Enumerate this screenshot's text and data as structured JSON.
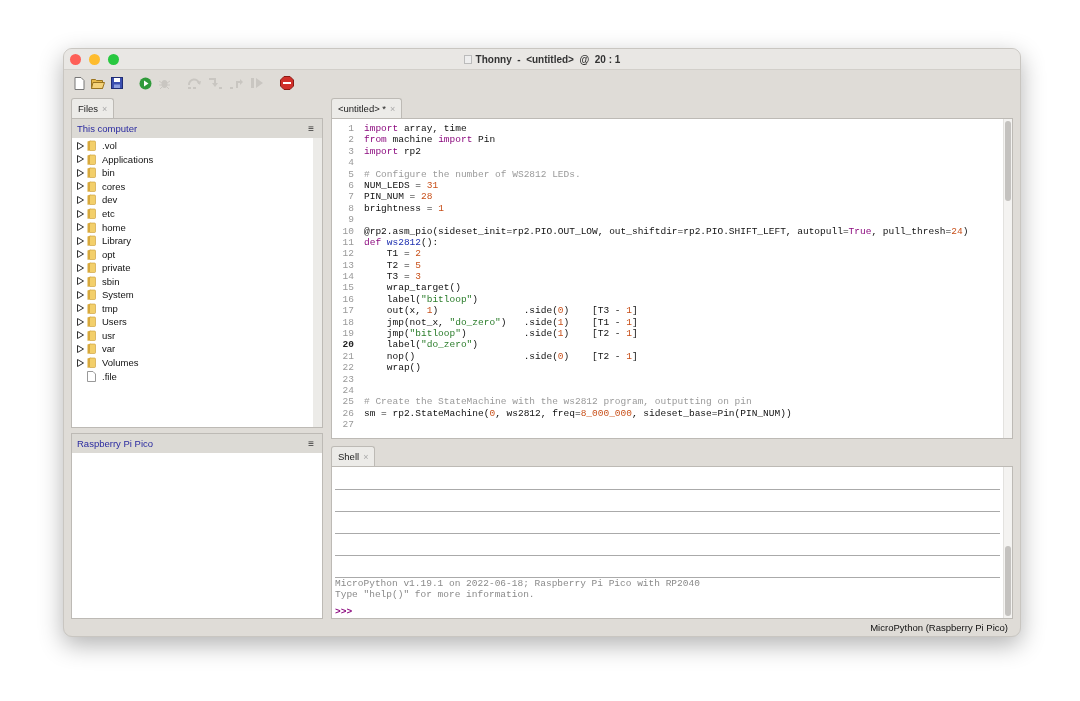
{
  "window": {
    "title": "Thonny  -  <untitled>  @  20 : 1"
  },
  "toolbar": [
    {
      "kind": "new",
      "disabled": false
    },
    {
      "kind": "open",
      "disabled": false
    },
    {
      "kind": "save",
      "disabled": false
    },
    {
      "kind": "run",
      "disabled": false
    },
    {
      "kind": "debug",
      "disabled": true
    },
    {
      "kind": "step_over",
      "disabled": true
    },
    {
      "kind": "step_into",
      "disabled": true
    },
    {
      "kind": "step_out",
      "disabled": true
    },
    {
      "kind": "resume",
      "disabled": true
    },
    {
      "kind": "stop",
      "disabled": false
    }
  ],
  "files": {
    "tab": {
      "label": "Files",
      "close": "×",
      "selected": true
    },
    "local": {
      "title": "This computer",
      "menu": "≡",
      "items": [
        {
          "name": ".vol",
          "kind": "folder",
          "expanded": false
        },
        {
          "name": "Applications",
          "kind": "folder",
          "expanded": false
        },
        {
          "name": "bin",
          "kind": "folder",
          "expanded": false
        },
        {
          "name": "cores",
          "kind": "folder",
          "expanded": false
        },
        {
          "name": "dev",
          "kind": "folder",
          "expanded": false
        },
        {
          "name": "etc",
          "kind": "folder",
          "expanded": false
        },
        {
          "name": "home",
          "kind": "folder",
          "expanded": false
        },
        {
          "name": "Library",
          "kind": "folder",
          "expanded": false
        },
        {
          "name": "opt",
          "kind": "folder",
          "expanded": false
        },
        {
          "name": "private",
          "kind": "folder",
          "expanded": false
        },
        {
          "name": "sbin",
          "kind": "folder",
          "expanded": false
        },
        {
          "name": "System",
          "kind": "folder",
          "expanded": false
        },
        {
          "name": "tmp",
          "kind": "folder",
          "expanded": false
        },
        {
          "name": "Users",
          "kind": "folder",
          "expanded": false
        },
        {
          "name": "usr",
          "kind": "folder",
          "expanded": false
        },
        {
          "name": "var",
          "kind": "folder",
          "expanded": false
        },
        {
          "name": "Volumes",
          "kind": "folder",
          "expanded": false
        },
        {
          "name": ".file",
          "kind": "file"
        }
      ]
    },
    "device": {
      "title": "Raspberry Pi Pico",
      "menu": "≡"
    }
  },
  "editor": {
    "tab": {
      "label": "<untitled> *",
      "close": "×",
      "selected": true
    },
    "lines": [
      {
        "number": "1",
        "current": false,
        "segments": [
          {
            "kind": "kw",
            "text": "import"
          },
          {
            "kind": "txt",
            "text": " array, time"
          }
        ]
      },
      {
        "number": "2",
        "current": false,
        "segments": [
          {
            "kind": "kw",
            "text": "from"
          },
          {
            "kind": "txt",
            "text": " machine "
          },
          {
            "kind": "kw",
            "text": "import"
          },
          {
            "kind": "txt",
            "text": " Pin"
          }
        ]
      },
      {
        "number": "3",
        "current": false,
        "segments": [
          {
            "kind": "kw",
            "text": "import"
          },
          {
            "kind": "txt",
            "text": " rp2"
          }
        ]
      },
      {
        "number": "4",
        "current": false
      },
      {
        "number": "5",
        "current": false,
        "segments": [
          {
            "kind": "com",
            "text": "# Configure the number of WS2812 LEDs."
          }
        ]
      },
      {
        "number": "6",
        "current": false,
        "segments": [
          {
            "kind": "txt",
            "text": "NUM_LEDS = "
          },
          {
            "kind": "num",
            "text": "31"
          }
        ]
      },
      {
        "number": "7",
        "current": false,
        "segments": [
          {
            "kind": "txt",
            "text": "PIN_NUM = "
          },
          {
            "kind": "num",
            "text": "28"
          }
        ]
      },
      {
        "number": "8",
        "current": false,
        "segments": [
          {
            "kind": "txt",
            "text": "brightness = "
          },
          {
            "kind": "num",
            "text": "1"
          }
        ]
      },
      {
        "number": "9",
        "current": false
      },
      {
        "number": "10",
        "current": false,
        "segments": [
          {
            "kind": "txt",
            "text": "@rp2.asm_pio(sideset_init=rp2.PIO.OUT_LOW, out_shiftdir=rp2.PIO.SHIFT_LEFT, autopull="
          },
          {
            "kind": "kw",
            "text": "True"
          },
          {
            "kind": "txt",
            "text": ", pull_thresh="
          },
          {
            "kind": "num",
            "text": "24"
          },
          {
            "kind": "txt",
            "text": ")"
          }
        ]
      },
      {
        "number": "11",
        "current": false,
        "segments": [
          {
            "kind": "kw",
            "text": "def"
          },
          {
            "kind": "fn",
            "text": " ws2812"
          },
          {
            "kind": "txt",
            "text": "():"
          }
        ]
      },
      {
        "number": "12",
        "current": false,
        "segments": [
          {
            "kind": "txt",
            "text": "    T1 = "
          },
          {
            "kind": "num",
            "text": "2"
          }
        ]
      },
      {
        "number": "13",
        "current": false,
        "segments": [
          {
            "kind": "txt",
            "text": "    T2 = "
          },
          {
            "kind": "num",
            "text": "5"
          }
        ]
      },
      {
        "number": "14",
        "current": false,
        "segments": [
          {
            "kind": "txt",
            "text": "    T3 = "
          },
          {
            "kind": "num",
            "text": "3"
          }
        ]
      },
      {
        "number": "15",
        "current": false,
        "segments": [
          {
            "kind": "txt",
            "text": "    wrap_target()"
          }
        ]
      },
      {
        "number": "16",
        "current": false,
        "segments": [
          {
            "kind": "txt",
            "text": "    label("
          },
          {
            "kind": "str",
            "text": "\"bitloop\""
          },
          {
            "kind": "txt",
            "text": ")"
          }
        ]
      },
      {
        "number": "17",
        "current": false,
        "segments": [
          {
            "kind": "txt",
            "text": "    out(x, "
          },
          {
            "kind": "num",
            "text": "1"
          },
          {
            "kind": "txt",
            "text": ")               .side("
          },
          {
            "kind": "num",
            "text": "0"
          },
          {
            "kind": "txt",
            "text": ")    [T3 - "
          },
          {
            "kind": "num",
            "text": "1"
          },
          {
            "kind": "txt",
            "text": "]"
          }
        ]
      },
      {
        "number": "18",
        "current": false,
        "segments": [
          {
            "kind": "txt",
            "text": "    jmp(not_x, "
          },
          {
            "kind": "str",
            "text": "\"do_zero\""
          },
          {
            "kind": "txt",
            "text": ")   .side("
          },
          {
            "kind": "num",
            "text": "1"
          },
          {
            "kind": "txt",
            "text": ")    [T1 - "
          },
          {
            "kind": "num",
            "text": "1"
          },
          {
            "kind": "txt",
            "text": "]"
          }
        ]
      },
      {
        "number": "19",
        "current": false,
        "segments": [
          {
            "kind": "txt",
            "text": "    jmp("
          },
          {
            "kind": "str",
            "text": "\"bitloop\""
          },
          {
            "kind": "txt",
            "text": ")          .side("
          },
          {
            "kind": "num",
            "text": "1"
          },
          {
            "kind": "txt",
            "text": ")    [T2 - "
          },
          {
            "kind": "num",
            "text": "1"
          },
          {
            "kind": "txt",
            "text": "]"
          }
        ]
      },
      {
        "number": "20",
        "current": true,
        "segments": [
          {
            "kind": "txt",
            "text": "    label("
          },
          {
            "kind": "str",
            "text": "\"do_zero\""
          },
          {
            "kind": "txt",
            "text": ")"
          }
        ]
      },
      {
        "number": "21",
        "current": false,
        "segments": [
          {
            "kind": "txt",
            "text": "    nop()                   .side("
          },
          {
            "kind": "num",
            "text": "0"
          },
          {
            "kind": "txt",
            "text": ")    [T2 - "
          },
          {
            "kind": "num",
            "text": "1"
          },
          {
            "kind": "txt",
            "text": "]"
          }
        ]
      },
      {
        "number": "22",
        "current": false,
        "segments": [
          {
            "kind": "txt",
            "text": "    wrap()"
          }
        ]
      },
      {
        "number": "23",
        "current": false
      },
      {
        "number": "24",
        "current": false
      },
      {
        "number": "25",
        "current": false,
        "segments": [
          {
            "kind": "com",
            "text": "# Create the StateMachine with the ws2812 program, outputting on pin"
          }
        ]
      },
      {
        "number": "26",
        "current": false,
        "segments": [
          {
            "kind": "txt",
            "text": "sm = rp2.StateMachine("
          },
          {
            "kind": "num",
            "text": "0"
          },
          {
            "kind": "txt",
            "text": ", ws2812, freq="
          },
          {
            "kind": "num",
            "text": "8_000_000"
          },
          {
            "kind": "txt",
            "text": ", sideset_base=Pin(PIN_NUM))"
          }
        ]
      },
      {
        "number": "27",
        "current": false
      }
    ]
  },
  "shell": {
    "tab": {
      "label": "Shell",
      "close": "×",
      "selected": true
    },
    "output": [
      "MicroPython v1.19.1 on 2022-06-18; Raspberry Pi Pico with RP2040",
      "Type \"help()\" for more information."
    ],
    "prompt": ">>>"
  },
  "status_bar": {
    "interpreter": "MicroPython (Raspberry Pi Pico)"
  }
}
